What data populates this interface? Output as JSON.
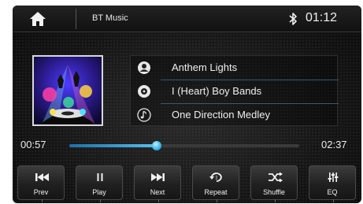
{
  "header": {
    "source_title": "BT Music",
    "clock": "01:12"
  },
  "tracks": [
    {
      "icon": "artist-icon",
      "label": "Anthem Lights"
    },
    {
      "icon": "album-icon",
      "label": "I (Heart) Boy Bands"
    },
    {
      "icon": "music-note-icon",
      "label": "One Direction Medley"
    }
  ],
  "playback": {
    "elapsed": "00:57",
    "total": "02:37",
    "progress_fraction": 0.38
  },
  "controls": [
    {
      "name": "prev-button",
      "icon": "skip-previous-icon",
      "label": "Prev"
    },
    {
      "name": "play-button",
      "icon": "pause-icon",
      "label": "Play"
    },
    {
      "name": "next-button",
      "icon": "skip-next-icon",
      "label": "Next"
    },
    {
      "name": "repeat-button",
      "icon": "repeat-icon",
      "label": "Repeat"
    },
    {
      "name": "shuffle-button",
      "icon": "shuffle-icon",
      "label": "Shuffle"
    },
    {
      "name": "eq-button",
      "icon": "equalizer-icon",
      "label": "EQ"
    }
  ],
  "colors": {
    "accent": "#3ab0e6",
    "background": "#161616",
    "text": "#efefef"
  }
}
